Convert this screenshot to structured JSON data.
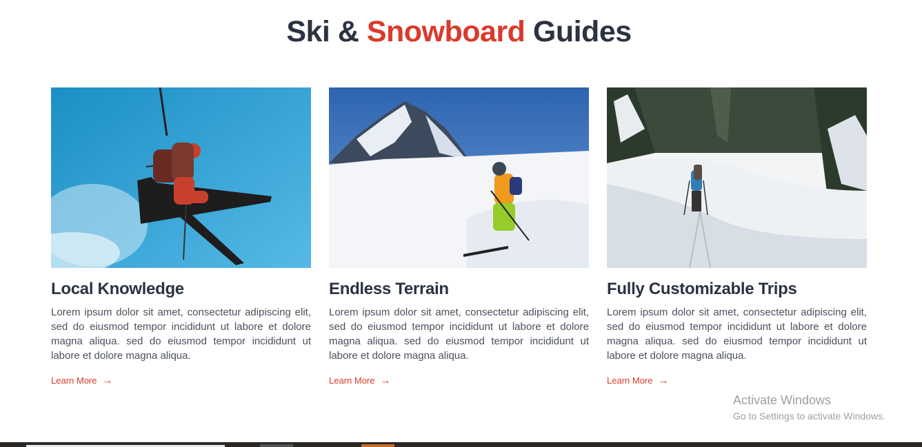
{
  "heading": {
    "part1": "Ski &",
    "accent": "Snowboard",
    "part2": "Guides"
  },
  "cards": [
    {
      "image_alt": "Freestyle skier mid-air against blue sky",
      "title": "Local Knowledge",
      "text": "Lorem ipsum dolor sit amet, consectetur adipiscing elit, sed do eiusmod tempor incididunt ut labore et dolore magna aliqua. sed do eiusmod tempor incididunt ut labore et dolore magna aliqua.",
      "link": "Learn More"
    },
    {
      "image_alt": "Skier carving down a snowy slope below a mountain peak",
      "title": "Endless Terrain",
      "text": "Lorem ipsum dolor sit amet, consectetur adipiscing elit, sed do eiusmod tempor incididunt ut labore et dolore magna aliqua. sed do eiusmod tempor incididunt ut labore et dolore magna aliqua.",
      "link": "Learn More"
    },
    {
      "image_alt": "Ski tourer walking through snowy forest",
      "title": "Fully Customizable Trips",
      "text": "Lorem ipsum dolor sit amet, consectetur adipiscing elit, sed do eiusmod tempor incididunt ut labore et dolore magna aliqua. sed do eiusmod tempor incididunt ut labore et dolore magna aliqua.",
      "link": "Learn More"
    }
  ],
  "arrow_icon": "→",
  "watermark": {
    "line1": "Activate Windows",
    "line2": "Go to Settings to activate Windows."
  },
  "colors": {
    "accent": "#d93a2b",
    "heading": "#2b3342",
    "body_text": "#4a4f5c"
  }
}
